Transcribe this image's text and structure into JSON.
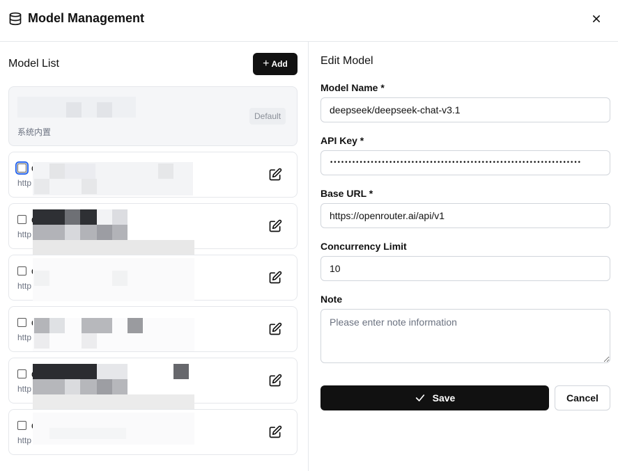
{
  "dialog": {
    "title": "Model Management",
    "title_icon": "database-icon",
    "close_icon": "close-icon"
  },
  "model_list": {
    "title": "Model List",
    "add_label": "Add",
    "default_item": {
      "subtitle": "系统内置",
      "badge": "Default"
    },
    "items": [
      {
        "name": "d",
        "url": "http",
        "checked": false,
        "focused": true
      },
      {
        "name": "d",
        "url": "http",
        "checked": false,
        "focused": false
      },
      {
        "name": "d",
        "url": "http",
        "checked": false,
        "focused": false
      },
      {
        "name": "d",
        "url": "http",
        "checked": false,
        "focused": false
      },
      {
        "name": "d",
        "url": "http",
        "checked": false,
        "focused": false
      },
      {
        "name": "d",
        "url": "http",
        "checked": false,
        "focused": false
      }
    ]
  },
  "edit_model": {
    "title": "Edit Model",
    "model_name_label": "Model Name *",
    "model_name_value": "deepseek/deepseek-chat-v3.1",
    "api_key_label": "API Key *",
    "api_key_value": "••••••••••••••••••••••••••••••••••••••••••••••••••••••••••••••••••••",
    "base_url_label": "Base URL *",
    "base_url_value": "https://openrouter.ai/api/v1",
    "concurrency_label": "Concurrency Limit",
    "concurrency_value": "10",
    "note_label": "Note",
    "note_placeholder": "Please enter note information",
    "save_label": "Save",
    "cancel_label": "Cancel"
  },
  "colors": {
    "primary": "#111111",
    "border": "#e5e7eb",
    "muted_text": "#6b7280"
  }
}
